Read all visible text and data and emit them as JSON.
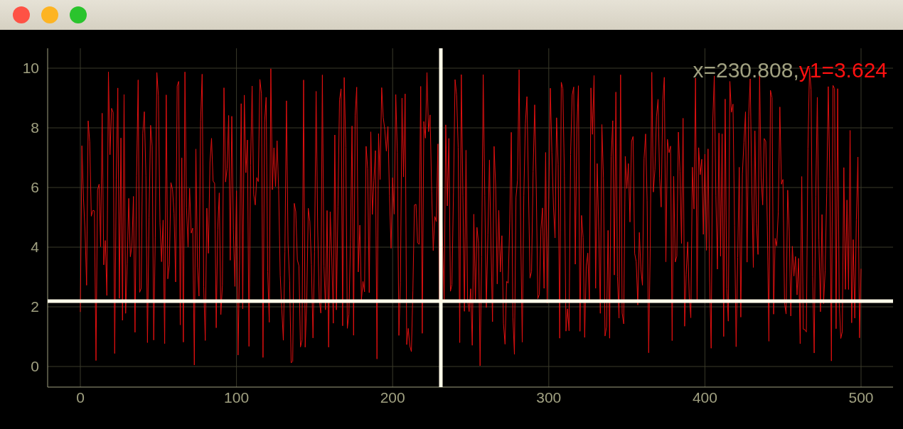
{
  "plot": {
    "readout": [
      {
        "text": "x=230.808,",
        "color": "#a0a080"
      },
      {
        "text": "y1=3.624",
        "color": "#ff1010"
      }
    ],
    "yticks": [
      "10",
      "8",
      "6",
      "4",
      "2",
      "0"
    ],
    "xticks": [
      "0",
      "100",
      "200",
      "300",
      "400",
      "500"
    ]
  }
}
